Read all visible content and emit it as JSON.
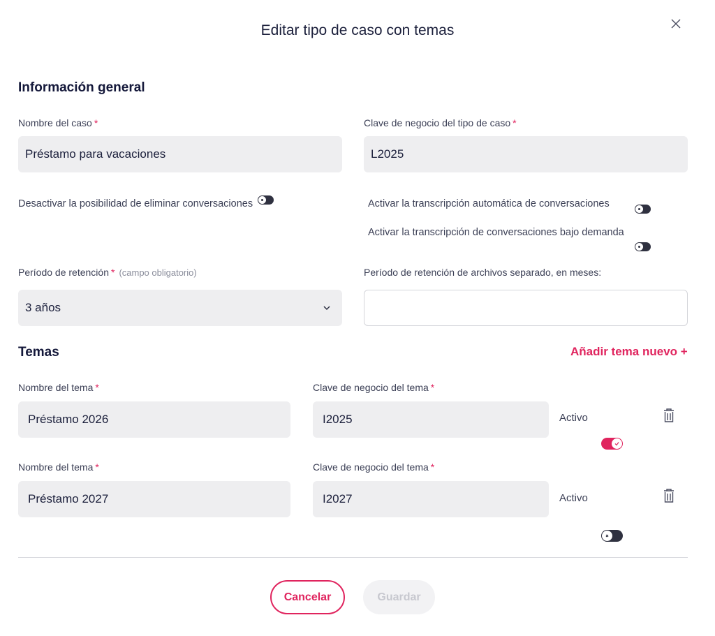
{
  "modal": {
    "title": "Editar tipo de caso con temas"
  },
  "general": {
    "heading": "Información general",
    "case_name": {
      "label": "Nombre del caso",
      "required": "*",
      "value": "Préstamo para vacaciones"
    },
    "business_key": {
      "label": "Clave de negocio del tipo de caso",
      "required": "*",
      "value": "L2025"
    },
    "disable_delete": {
      "label": "Desactivar la posibilidad de eliminar conversaciones",
      "on": false
    },
    "auto_transcription": {
      "label": "Activar la transcripción automática de conversaciones",
      "on": false
    },
    "ondemand_transcription": {
      "label": "Activar la transcripción de conversaciones bajo demanda",
      "on": false
    },
    "retention": {
      "label": "Período de retención",
      "required": "*",
      "hint": "(campo obligatorio)",
      "value": "3 años"
    },
    "file_retention": {
      "label": "Período de retención de archivos separado, en meses:",
      "value": ""
    }
  },
  "topics": {
    "heading": "Temas",
    "add_label": "Añadir tema nuevo +",
    "items": [
      {
        "name_label": "Nombre del tema",
        "required": "*",
        "name": "Préstamo 2026",
        "key_label": "Clave de negocio del tema",
        "key": "I2025",
        "active_label": "Activo",
        "active": true
      },
      {
        "name_label": "Nombre del tema",
        "required": "*",
        "name": "Préstamo 2027",
        "key_label": "Clave de negocio del tema",
        "key": "I2027",
        "active_label": "Activo",
        "active": false
      }
    ]
  },
  "footer": {
    "cancel_label": "Cancelar",
    "save_label": "Guardar"
  },
  "colors": {
    "accent": "#e0245e",
    "field_bg": "#eeeef0",
    "text_dark": "#1b1f3b"
  },
  "icons": {
    "close": "close-icon",
    "chevron": "chevron-down-icon",
    "trash": "trash-icon"
  }
}
